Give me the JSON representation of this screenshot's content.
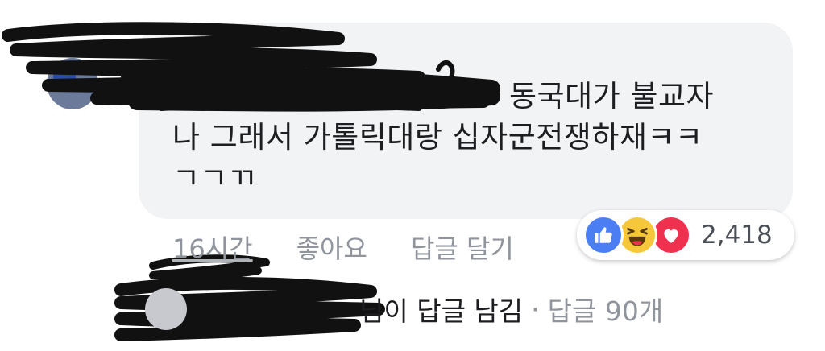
{
  "comment": {
    "text_line1": "동국대가 불교자",
    "text_line2": "나 그래서 가톨릭대랑 십자군전쟁하재ㅋㅋ",
    "text_line3": "ㄱㄱㄲ"
  },
  "actions": {
    "time": "16시간",
    "like": "좋아요",
    "reply": "답글 달기"
  },
  "reactions": {
    "icons": [
      "like-icon",
      "haha-icon",
      "love-icon"
    ],
    "count": "2,418",
    "colors": {
      "like": "#4b7ef2",
      "haha": "#f7c73b",
      "love": "#f0304f"
    }
  },
  "reply_summary": {
    "who_suffix": "님이 답글 남김",
    "separator": "·",
    "count": "답글 90개"
  }
}
